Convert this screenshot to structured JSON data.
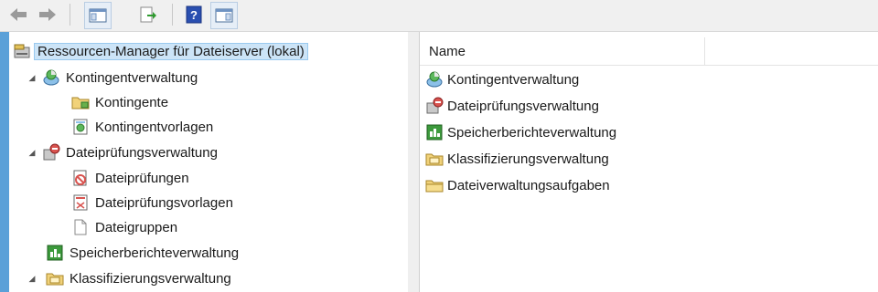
{
  "toolbar": {
    "buttons": [
      {
        "icon": "back-arrow-icon"
      },
      {
        "icon": "forward-arrow-icon"
      },
      {
        "icon": "show-hide-console-tree-icon"
      },
      {
        "icon": "export-list-icon"
      },
      {
        "icon": "help-icon"
      },
      {
        "icon": "show-hide-action-pane-icon"
      }
    ]
  },
  "tree": {
    "root": {
      "label": "Ressourcen-Manager für Dateiserver (lokal)",
      "icon": "server-resource-manager-icon",
      "selected": true
    },
    "items": [
      {
        "label": "Kontingentverwaltung",
        "icon": "quota-management-icon",
        "expanded": true
      },
      {
        "label": "Kontingente",
        "icon": "quotas-folder-icon"
      },
      {
        "label": "Kontingentvorlagen",
        "icon": "quota-templates-icon"
      },
      {
        "label": "Dateiprüfungsverwaltung",
        "icon": "file-screening-icon",
        "expanded": true
      },
      {
        "label": "Dateiprüfungen",
        "icon": "file-screens-icon"
      },
      {
        "label": "Dateiprüfungsvorlagen",
        "icon": "file-screen-templates-icon"
      },
      {
        "label": "Dateigruppen",
        "icon": "file-groups-icon"
      },
      {
        "label": "Speicherberichteverwaltung",
        "icon": "storage-reports-icon"
      },
      {
        "label": "Klassifizierungsverwaltung",
        "icon": "classification-management-icon",
        "expanded": true
      }
    ]
  },
  "list": {
    "column_header": "Name",
    "items": [
      {
        "label": "Kontingentverwaltung",
        "icon": "quota-management-icon"
      },
      {
        "label": "Dateiprüfungsverwaltung",
        "icon": "file-screening-icon"
      },
      {
        "label": "Speicherberichteverwaltung",
        "icon": "storage-reports-icon"
      },
      {
        "label": "Klassifizierungsverwaltung",
        "icon": "classification-management-icon"
      },
      {
        "label": "Dateiverwaltungsaufgaben",
        "icon": "file-management-tasks-icon"
      }
    ]
  }
}
